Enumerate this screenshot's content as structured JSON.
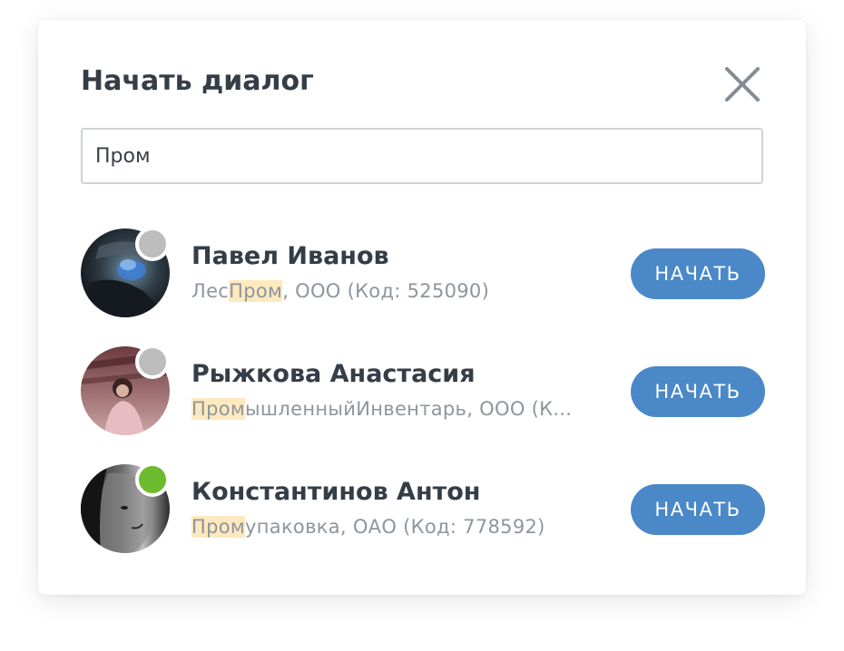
{
  "dialog": {
    "title": "Начать диалог",
    "close_icon": "close-icon"
  },
  "search": {
    "value": "Пром",
    "placeholder": ""
  },
  "colors": {
    "accent": "#4a88c8",
    "highlight": "#fde9bf",
    "online": "#6dbb2f",
    "offline": "#bdbdbd"
  },
  "contacts": [
    {
      "name": "Павел Иванов",
      "org_before": "Лес",
      "org_match": "Пром",
      "org_after": ", ООО (Код: 525090)",
      "status": "offline",
      "button": "НАЧАТЬ"
    },
    {
      "name": "Рыжкова Анастасия",
      "org_before": "",
      "org_match": "Пром",
      "org_after": "ышленныйИнвентарь, ООО (К...",
      "status": "offline",
      "button": "НАЧАТЬ"
    },
    {
      "name": "Константинов Антон",
      "org_before": "",
      "org_match": "Пром",
      "org_after": "упаковка, ОАО (Код: 778592)",
      "status": "online",
      "button": "НАЧАТЬ"
    }
  ]
}
